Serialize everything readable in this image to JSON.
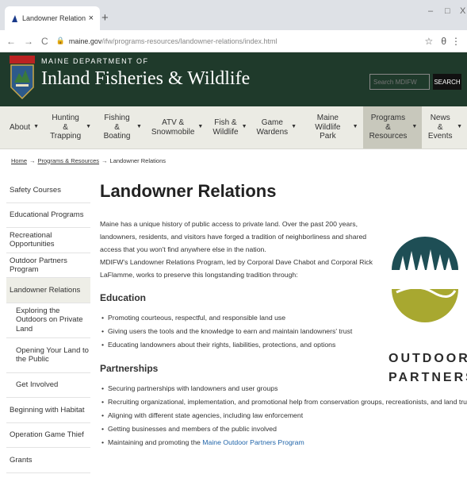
{
  "browser": {
    "tab_title": "Landowner Relations & Program",
    "tab_close": "×",
    "new_tab": "+",
    "url_host": "maine.gov",
    "url_path": "/ifw/programs-resources/landowner-relations/index.html",
    "window_minimize": "–",
    "window_maximize": "□",
    "window_close": "X"
  },
  "header": {
    "dept_label": "MAINE DEPARTMENT OF",
    "agency_name": "Inland Fisheries & Wildlife",
    "search_placeholder": "Search MDIFW",
    "search_button": "SEARCH"
  },
  "nav": [
    {
      "line1": "About",
      "line2": ""
    },
    {
      "line1": "Hunting &",
      "line2": "Trapping"
    },
    {
      "line1": "Fishing &",
      "line2": "Boating"
    },
    {
      "line1": "ATV &",
      "line2": "Snowmobile"
    },
    {
      "line1": "Fish &",
      "line2": "Wildlife"
    },
    {
      "line1": "Game",
      "line2": "Wardens"
    },
    {
      "line1": "Maine",
      "line2": "Wildlife Park"
    },
    {
      "line1": "Programs &",
      "line2": "Resources"
    },
    {
      "line1": "News &",
      "line2": "Events"
    }
  ],
  "breadcrumb": {
    "home": "Home",
    "sep": "→",
    "programs": "Programs & Resources",
    "current": "Landowner Relations"
  },
  "sidebar": [
    "Safety Courses",
    "Educational Programs",
    "Recreational Opportunities",
    "Outdoor Partners Program",
    "Landowner Relations",
    "Exploring the Outdoors on Private Land",
    "Opening Your Land to the Public",
    "Get Involved",
    "Beginning with Habitat",
    "Operation Game Thief",
    "Grants"
  ],
  "main": {
    "title": "Landowner Relations",
    "intro1": "Maine has a unique history of public access to private land. Over the past 200 years, landowners, residents, and visitors have forged a tradition of neighborliness and shared access that you won't find anywhere else in the nation.",
    "intro2": "MDIFW's Landowner Relations Program, led by Corporal Dave Chabot and Corporal Rick LaFlamme, works to preserve this longstanding tradition through:",
    "education_heading": "Education",
    "education_items": [
      "Promoting courteous, respectful, and responsible land use",
      "Giving users the tools and the knowledge to earn and maintain landowners' trust",
      "Educating landowners about their rights, liabilities, protections, and options"
    ],
    "partnerships_heading": "Partnerships",
    "partnership_items": [
      "Securing partnerships with landowners and user groups",
      "Recruiting organizational, implementation, and promotional help from conservation groups, recreationists, and land trusts",
      "Aligning with different state agencies, including law enforcement",
      "Getting businesses and members of the public involved"
    ],
    "last_item_prefix": "Maintaining and promoting the ",
    "last_item_link": "Maine Outdoor Partners Program"
  },
  "outdoor_partners": {
    "line1": "OUTDOOR",
    "line2": "PARTNERS"
  },
  "colors": {
    "header_bg": "#1f3a2b",
    "nav_bg": "#ebebe4",
    "teal": "#1e4e55",
    "olive": "#a8a830",
    "link": "#2266aa"
  }
}
